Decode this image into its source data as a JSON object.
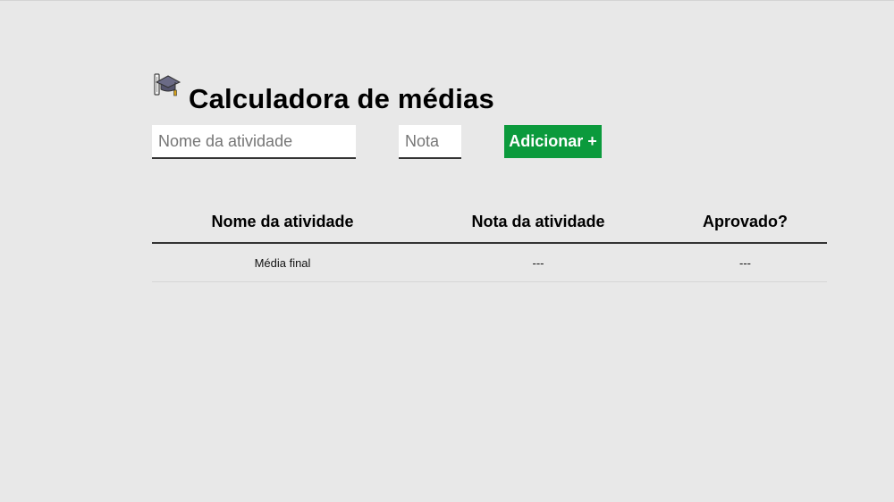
{
  "page": {
    "title": "Calculadora de médias",
    "logo_icon": "graduation-cap-diploma-icon",
    "background_color": "#e8e8e8"
  },
  "form": {
    "activity_name": {
      "value": "",
      "placeholder": "Nome da atividade"
    },
    "grade": {
      "value": "",
      "placeholder": "Nota"
    },
    "add_button_label": "Adicionar +",
    "add_button_color": "#0b9a3c"
  },
  "table": {
    "headers": [
      "Nome da atividade",
      "Nota da atividade",
      "Aprovado?"
    ],
    "rows": [
      [
        "Média final",
        "---",
        "---"
      ]
    ]
  }
}
